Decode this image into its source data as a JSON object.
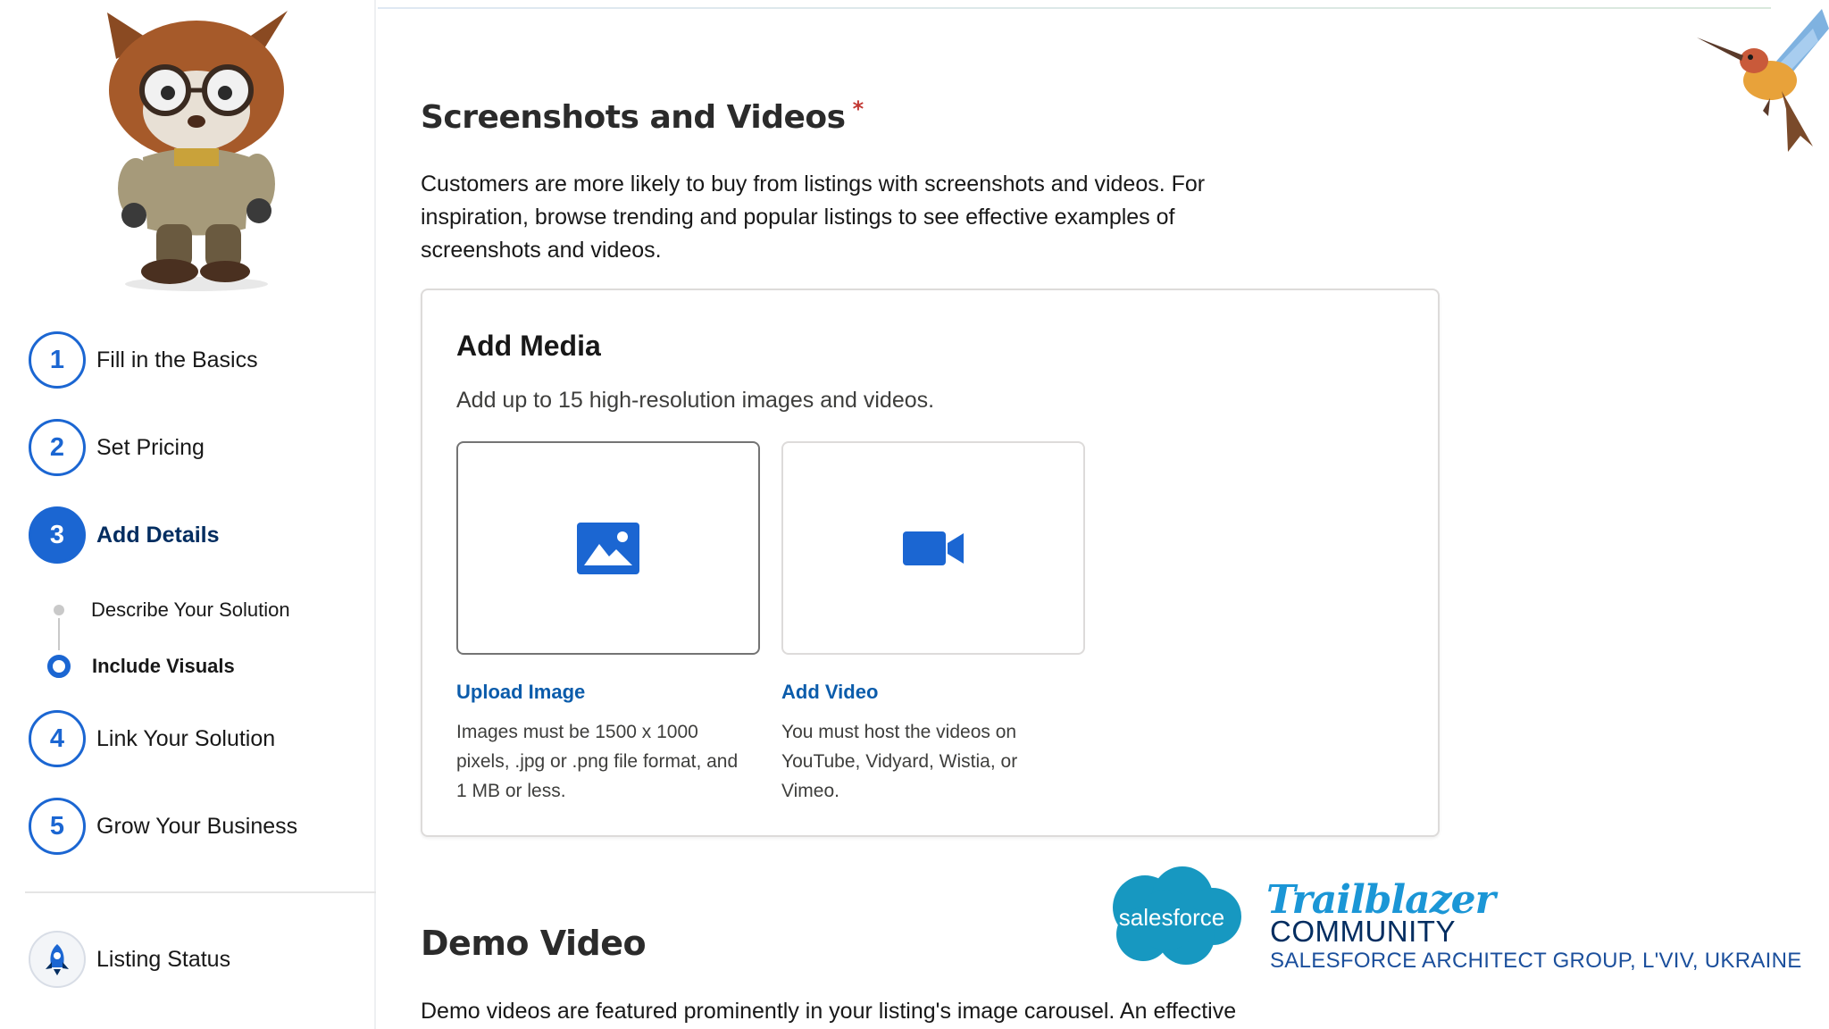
{
  "sidebar": {
    "steps": [
      {
        "number": "1",
        "label": "Fill in the Basics"
      },
      {
        "number": "2",
        "label": "Set Pricing"
      },
      {
        "number": "3",
        "label": "Add Details"
      },
      {
        "number": "4",
        "label": "Link Your Solution"
      },
      {
        "number": "5",
        "label": "Grow Your Business"
      }
    ],
    "active_step": "3",
    "substeps": [
      {
        "label": "Describe Your Solution",
        "state": "complete"
      },
      {
        "label": "Include Visuals",
        "state": "current"
      }
    ],
    "listing_status": {
      "label": "Listing Status",
      "icon": "rocket-icon"
    },
    "mascot": "astro-mascot"
  },
  "main": {
    "screenshots_section": {
      "title": "Screenshots and Videos",
      "required_marker": "*",
      "description": "Customers are more likely to buy from listings with screenshots and videos. For inspiration, browse trending and popular listings to see effective examples of screenshots and videos."
    },
    "add_media": {
      "title": "Add Media",
      "description": "Add up to 15 high-resolution images and videos.",
      "upload_image": {
        "icon": "image-icon",
        "link": "Upload Image",
        "note": "Images must be 1500 x 1000 pixels, .jpg or .png file format, and 1 MB or less."
      },
      "add_video": {
        "icon": "video-camera-icon",
        "link": "Add Video",
        "note": "You must host the videos on YouTube, Vidyard, Wistia, or Vimeo."
      }
    },
    "demo_section": {
      "title": "Demo Video",
      "description": "Demo videos are featured prominently in your listing's image carousel. An effective"
    }
  },
  "branding": {
    "salesforce_logo_text": "salesforce",
    "trailblazer": "Trailblazer",
    "community": "COMMUNITY",
    "group": "SALESFORCE ARCHITECT GROUP, L'VIV, UKRAINE"
  },
  "colors": {
    "brand_blue": "#1b66d2",
    "link_blue": "#0b5cab",
    "required_red": "#c23934",
    "salesforce_cloud": "#1798c1"
  }
}
